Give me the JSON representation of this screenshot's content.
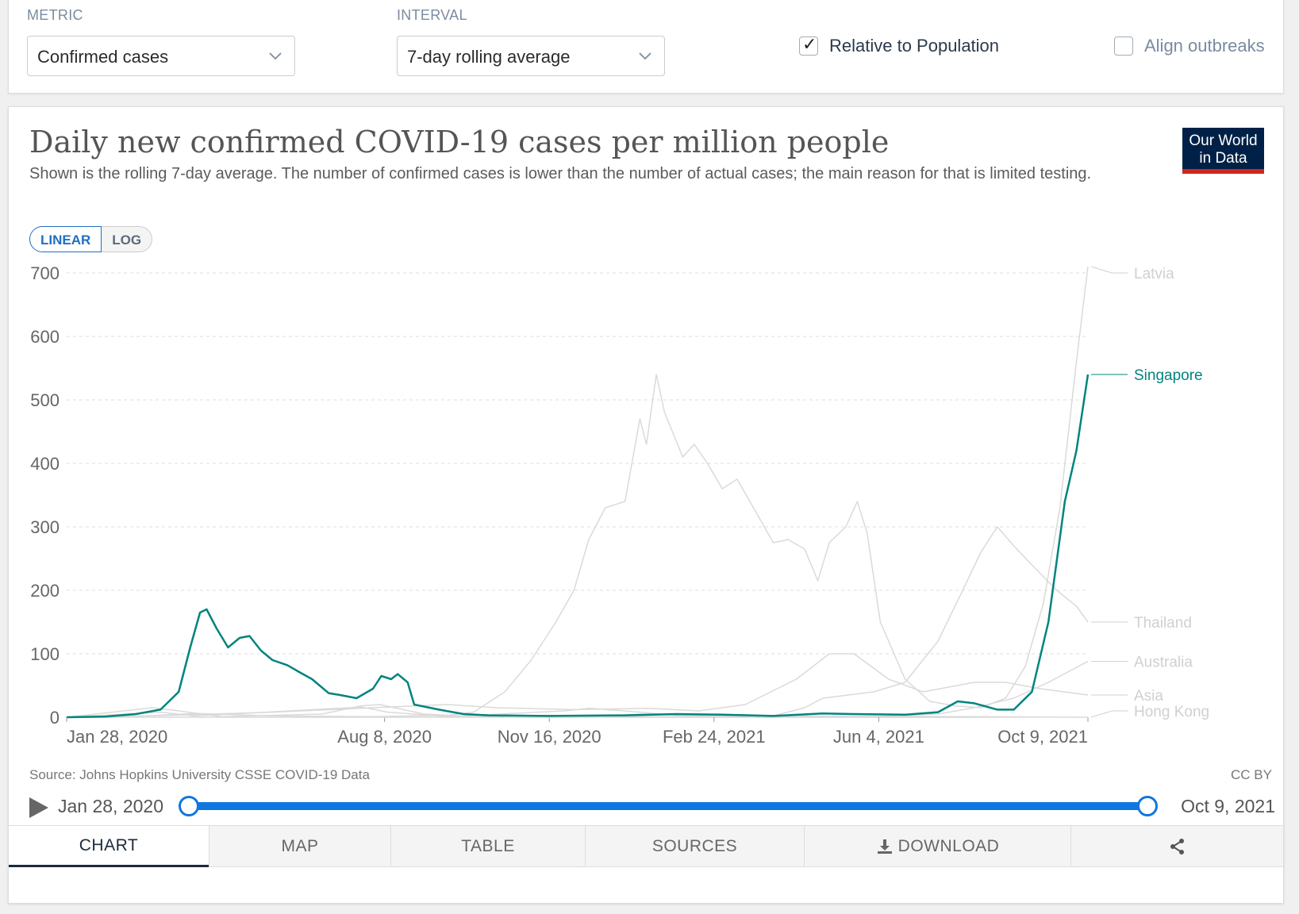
{
  "controls": {
    "metric_label": "METRIC",
    "metric_value": "Confirmed cases",
    "interval_label": "INTERVAL",
    "interval_value": "7-day rolling average",
    "relative_label": "Relative to Population",
    "relative_checked": true,
    "align_label": "Align outbreaks",
    "align_checked": false
  },
  "chart_card": {
    "title": "Daily new confirmed COVID-19 cases per million people",
    "subtitle": "Shown is the rolling 7-day average. The number of confirmed cases is lower than the number of actual cases; the main reason for that is limited testing.",
    "logo_line1": "Our World",
    "logo_line2": "in Data",
    "scale_linear": "LINEAR",
    "scale_log": "LOG",
    "source": "Source: Johns Hopkins University CSSE COVID-19 Data",
    "license": "CC BY"
  },
  "timeline": {
    "start": "Jan 28, 2020",
    "end": "Oct 9, 2021"
  },
  "tabs": {
    "chart": "CHART",
    "map": "MAP",
    "table": "TABLE",
    "sources": "SOURCES",
    "download": "DOWNLOAD"
  },
  "colors": {
    "highlight": "#00847e",
    "muted": "#dadada",
    "accent": "#1077e0"
  },
  "chart_data": {
    "type": "line",
    "title": "Daily new confirmed COVID-19 cases per million people",
    "xlabel": "",
    "ylabel": "",
    "ylim": [
      0,
      700
    ],
    "xlim": [
      "2020-01-28",
      "2021-10-09"
    ],
    "y_ticks": [
      0,
      100,
      200,
      300,
      400,
      500,
      600,
      700
    ],
    "x_ticks": [
      "Jan 28, 2020",
      "Aug 8, 2020",
      "Nov 16, 2020",
      "Feb 24, 2021",
      "Jun 4, 2021",
      "Oct 9, 2021"
    ],
    "x_tick_dates": [
      "2020-01-28",
      "2020-08-08",
      "2020-11-16",
      "2021-02-24",
      "2021-06-04",
      "2021-10-09"
    ],
    "grid": true,
    "series": [
      {
        "name": "Latvia",
        "highlighted": false,
        "points": [
          [
            "2020-01-28",
            0
          ],
          [
            "2020-03-15",
            2
          ],
          [
            "2020-04-15",
            6
          ],
          [
            "2020-06-01",
            2
          ],
          [
            "2020-08-01",
            1
          ],
          [
            "2020-09-15",
            3
          ],
          [
            "2020-10-01",
            8
          ],
          [
            "2020-10-20",
            40
          ],
          [
            "2020-11-05",
            90
          ],
          [
            "2020-11-20",
            150
          ],
          [
            "2020-12-01",
            200
          ],
          [
            "2020-12-10",
            280
          ],
          [
            "2020-12-20",
            330
          ],
          [
            "2021-01-01",
            340
          ],
          [
            "2021-01-10",
            470
          ],
          [
            "2021-01-14",
            430
          ],
          [
            "2021-01-20",
            540
          ],
          [
            "2021-01-25",
            480
          ],
          [
            "2021-02-05",
            410
          ],
          [
            "2021-02-12",
            430
          ],
          [
            "2021-02-20",
            400
          ],
          [
            "2021-03-01",
            360
          ],
          [
            "2021-03-10",
            375
          ],
          [
            "2021-03-20",
            330
          ],
          [
            "2021-04-01",
            275
          ],
          [
            "2021-04-10",
            280
          ],
          [
            "2021-04-20",
            265
          ],
          [
            "2021-04-28",
            215
          ],
          [
            "2021-05-05",
            275
          ],
          [
            "2021-05-15",
            300
          ],
          [
            "2021-05-22",
            340
          ],
          [
            "2021-05-28",
            290
          ],
          [
            "2021-06-05",
            150
          ],
          [
            "2021-06-20",
            60
          ],
          [
            "2021-07-05",
            25
          ],
          [
            "2021-07-20",
            18
          ],
          [
            "2021-08-05",
            15
          ],
          [
            "2021-08-20",
            30
          ],
          [
            "2021-09-01",
            80
          ],
          [
            "2021-09-12",
            180
          ],
          [
            "2021-09-22",
            330
          ],
          [
            "2021-10-02",
            560
          ],
          [
            "2021-10-09",
            710
          ]
        ]
      },
      {
        "name": "Singapore",
        "highlighted": true,
        "points": [
          [
            "2020-01-28",
            0
          ],
          [
            "2020-02-20",
            1
          ],
          [
            "2020-03-10",
            5
          ],
          [
            "2020-03-25",
            12
          ],
          [
            "2020-04-05",
            40
          ],
          [
            "2020-04-12",
            110
          ],
          [
            "2020-04-18",
            165
          ],
          [
            "2020-04-22",
            170
          ],
          [
            "2020-04-28",
            140
          ],
          [
            "2020-05-05",
            110
          ],
          [
            "2020-05-12",
            125
          ],
          [
            "2020-05-18",
            128
          ],
          [
            "2020-05-25",
            105
          ],
          [
            "2020-06-01",
            90
          ],
          [
            "2020-06-10",
            82
          ],
          [
            "2020-06-18",
            70
          ],
          [
            "2020-06-25",
            60
          ],
          [
            "2020-07-05",
            38
          ],
          [
            "2020-07-12",
            35
          ],
          [
            "2020-07-22",
            30
          ],
          [
            "2020-08-01",
            45
          ],
          [
            "2020-08-06",
            65
          ],
          [
            "2020-08-12",
            60
          ],
          [
            "2020-08-16",
            68
          ],
          [
            "2020-08-22",
            55
          ],
          [
            "2020-08-26",
            20
          ],
          [
            "2020-09-10",
            12
          ],
          [
            "2020-09-25",
            5
          ],
          [
            "2020-10-10",
            3
          ],
          [
            "2020-11-15",
            2
          ],
          [
            "2021-01-01",
            3
          ],
          [
            "2021-02-01",
            5
          ],
          [
            "2021-03-01",
            4
          ],
          [
            "2021-04-01",
            2
          ],
          [
            "2021-05-01",
            6
          ],
          [
            "2021-05-20",
            5
          ],
          [
            "2021-06-20",
            4
          ],
          [
            "2021-07-10",
            8
          ],
          [
            "2021-07-22",
            25
          ],
          [
            "2021-08-01",
            22
          ],
          [
            "2021-08-15",
            12
          ],
          [
            "2021-08-25",
            12
          ],
          [
            "2021-09-05",
            40
          ],
          [
            "2021-09-15",
            150
          ],
          [
            "2021-09-25",
            340
          ],
          [
            "2021-10-02",
            420
          ],
          [
            "2021-10-09",
            540
          ]
        ]
      },
      {
        "name": "Thailand",
        "highlighted": false,
        "points": [
          [
            "2020-01-28",
            0
          ],
          [
            "2020-12-15",
            0
          ],
          [
            "2021-01-10",
            5
          ],
          [
            "2021-04-01",
            2
          ],
          [
            "2021-04-20",
            15
          ],
          [
            "2021-05-01",
            30
          ],
          [
            "2021-06-01",
            40
          ],
          [
            "2021-06-20",
            55
          ],
          [
            "2021-07-10",
            120
          ],
          [
            "2021-07-25",
            200
          ],
          [
            "2021-08-05",
            260
          ],
          [
            "2021-08-15",
            300
          ],
          [
            "2021-08-25",
            270
          ],
          [
            "2021-09-05",
            240
          ],
          [
            "2021-09-20",
            200
          ],
          [
            "2021-10-02",
            175
          ],
          [
            "2021-10-09",
            150
          ]
        ]
      },
      {
        "name": "Australia",
        "highlighted": false,
        "points": [
          [
            "2020-01-28",
            0
          ],
          [
            "2020-03-20",
            15
          ],
          [
            "2020-04-05",
            10
          ],
          [
            "2020-05-01",
            1
          ],
          [
            "2020-07-01",
            5
          ],
          [
            "2020-07-25",
            18
          ],
          [
            "2020-08-05",
            20
          ],
          [
            "2020-09-01",
            5
          ],
          [
            "2020-10-01",
            1
          ],
          [
            "2021-06-01",
            1
          ],
          [
            "2021-07-10",
            5
          ],
          [
            "2021-08-01",
            15
          ],
          [
            "2021-08-25",
            30
          ],
          [
            "2021-09-15",
            55
          ],
          [
            "2021-10-09",
            88
          ]
        ]
      },
      {
        "name": "Asia",
        "highlighted": false,
        "points": [
          [
            "2020-01-28",
            0
          ],
          [
            "2020-04-01",
            3
          ],
          [
            "2020-06-01",
            8
          ],
          [
            "2020-08-01",
            15
          ],
          [
            "2020-09-15",
            20
          ],
          [
            "2020-10-15",
            15
          ],
          [
            "2020-12-01",
            12
          ],
          [
            "2021-01-15",
            14
          ],
          [
            "2021-02-15",
            10
          ],
          [
            "2021-03-15",
            20
          ],
          [
            "2021-04-15",
            60
          ],
          [
            "2021-05-05",
            100
          ],
          [
            "2021-05-20",
            100
          ],
          [
            "2021-06-10",
            60
          ],
          [
            "2021-07-01",
            40
          ],
          [
            "2021-08-01",
            55
          ],
          [
            "2021-08-20",
            55
          ],
          [
            "2021-09-10",
            45
          ],
          [
            "2021-10-09",
            35
          ]
        ]
      },
      {
        "name": "Hong Kong",
        "highlighted": false,
        "points": [
          [
            "2020-01-28",
            0
          ],
          [
            "2020-03-25",
            8
          ],
          [
            "2020-04-15",
            2
          ],
          [
            "2020-07-25",
            16
          ],
          [
            "2020-08-10",
            8
          ],
          [
            "2020-09-15",
            1
          ],
          [
            "2020-11-25",
            10
          ],
          [
            "2020-12-10",
            14
          ],
          [
            "2021-01-01",
            10
          ],
          [
            "2021-02-01",
            3
          ],
          [
            "2021-10-09",
            0
          ]
        ]
      }
    ]
  }
}
